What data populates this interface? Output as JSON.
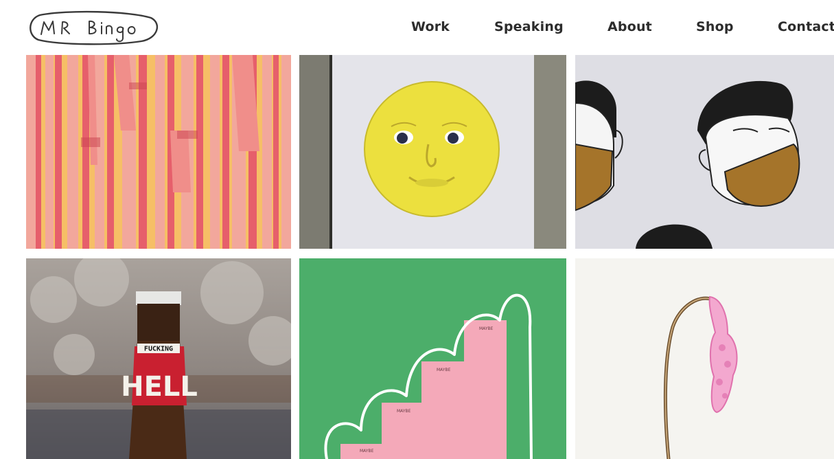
{
  "header": {
    "logo_text": "MR Bingo",
    "nav": [
      {
        "label": "Work"
      },
      {
        "label": "Speaking"
      },
      {
        "label": "About"
      },
      {
        "label": "Shop"
      },
      {
        "label": "Contact"
      }
    ]
  },
  "gallery": {
    "tiles": [
      {
        "subject": "striped-lettering-artwork"
      },
      {
        "subject": "moon-face-print"
      },
      {
        "subject": "masked-faces-print"
      },
      {
        "subject": "beer-bottle-photo",
        "label_top": "FUCKING",
        "label_main": "HELL"
      },
      {
        "subject": "pink-staircase-print",
        "step_label": "MAYBE"
      },
      {
        "subject": "drooping-flower-print"
      }
    ]
  },
  "colors": {
    "nav_text": "#2c2c2c",
    "stripe_pink": "#f08e8a",
    "stripe_yellow": "#f7c35c",
    "moon_yellow": "#ece03e",
    "mask_brown": "#a5742a",
    "green": "#4cae6a",
    "pink": "#f4a9b9",
    "beer_red": "#c92030"
  }
}
